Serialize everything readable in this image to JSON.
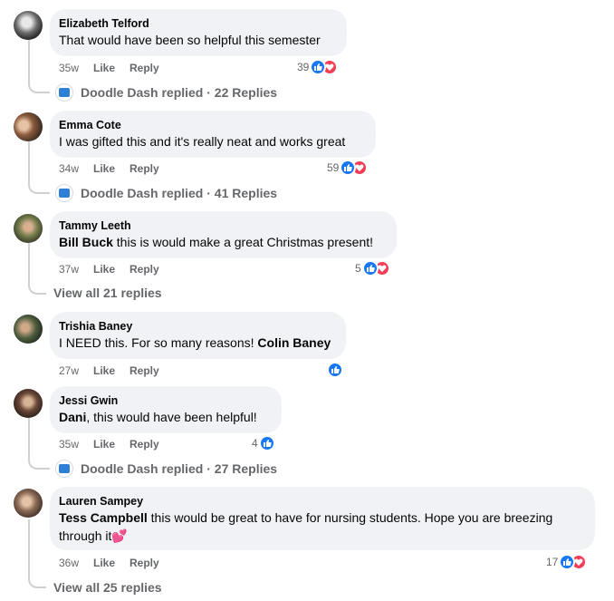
{
  "colors": {
    "like": "#1877f2",
    "love": "#f33e58",
    "bubble": "#f0f2f5",
    "meta": "#65676b"
  },
  "actions": {
    "like": "Like",
    "reply": "Reply"
  },
  "comments": [
    {
      "author": "Elizabeth Telford",
      "text": "That would have been so helpful this semester",
      "time": "35w",
      "reactions": "39",
      "reply_summary": "Doodle Dash replied · 22 Replies"
    },
    {
      "author": "Emma Cote",
      "text": "I was gifted this and it's really neat and works great",
      "time": "34w",
      "reactions": "59",
      "reply_summary": "Doodle Dash replied · 41 Replies"
    },
    {
      "author": "Tammy Leeth",
      "mention": "Bill Buck",
      "text": " this is would make a great Christmas present!",
      "time": "37w",
      "reactions": "5",
      "view_all": "View all 21 replies"
    },
    {
      "author": "Trishia Baney",
      "text": "I NEED this. For so many reasons! ",
      "mention_after": "Colin Baney",
      "time": "27w",
      "reactions": ""
    },
    {
      "author": "Jessi Gwin",
      "mention": "Dani",
      "text": ", this would have been helpful!",
      "time": "35w",
      "reactions": "4",
      "reply_summary": "Doodle Dash replied · 27 Replies"
    },
    {
      "author": "Lauren Sampey",
      "mention": "Tess Campbell",
      "text": " this would be great to have for nursing students. Hope you are breezing through it",
      "emoji": "💕",
      "time": "36w",
      "reactions": "17",
      "view_all": "View all 25 replies"
    }
  ]
}
